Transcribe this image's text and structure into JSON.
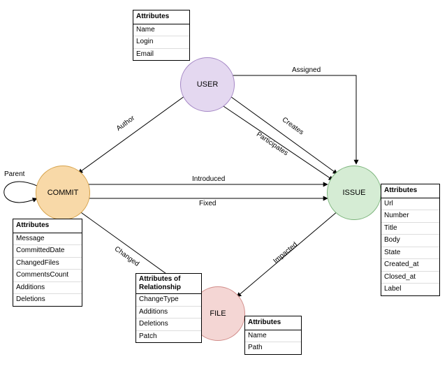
{
  "nodes": {
    "user": {
      "label": "USER"
    },
    "commit": {
      "label": "COMMIT"
    },
    "issue": {
      "label": "ISSUE"
    },
    "file": {
      "label": "FILE"
    }
  },
  "tables": {
    "user_attrs": {
      "header": "Attributes",
      "rows": [
        "Name",
        "Login",
        "Email"
      ]
    },
    "commit_attrs": {
      "header": "Attributes",
      "rows": [
        "Message",
        "CommittedDate",
        "ChangedFiles",
        "CommentsCount",
        "Additions",
        "Deletions"
      ]
    },
    "issue_attrs": {
      "header": "Attributes",
      "rows": [
        "Url",
        "Number",
        "Title",
        "Body",
        "State",
        "Created_at",
        "Closed_at",
        "Label"
      ]
    },
    "file_attrs": {
      "header": "Attributes",
      "rows": [
        "Name",
        "Path"
      ]
    },
    "rel_attrs": {
      "header": "Attributes of Relationship",
      "rows": [
        "ChangeType",
        "Additions",
        "Deletions",
        "Patch"
      ]
    }
  },
  "edges": {
    "author": {
      "label": "Author"
    },
    "assigned": {
      "label": "Assigned"
    },
    "creates": {
      "label": "Creates"
    },
    "participates": {
      "label": "Participates"
    },
    "introduced": {
      "label": "Introduced"
    },
    "fixed": {
      "label": "Fixed"
    },
    "changed": {
      "label": "Changed"
    },
    "impacted": {
      "label": "Impacted"
    },
    "parent": {
      "label": "Parent"
    }
  }
}
